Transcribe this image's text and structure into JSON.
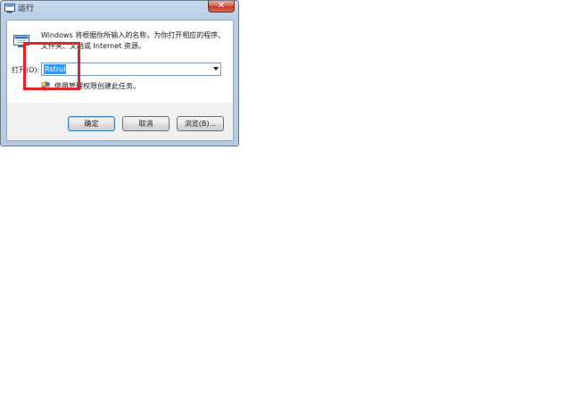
{
  "dialog": {
    "title": "运行",
    "close_glyph": "✕",
    "description": "Windows 将根据你所输入的名称，为你打开相应的程序、文件夹、文档或 Internet 资源。",
    "open_label": "打开(O):",
    "open_value": "Rstrui",
    "admin_note": "使用管理权限创建此任务。",
    "buttons": {
      "ok": "确定",
      "cancel": "取消",
      "browse": "浏览(B)..."
    }
  },
  "icons": {
    "title": "run-app-icon",
    "main": "run-app-icon",
    "shield": "uac-shield-icon",
    "dropdown": "chevron-down-icon"
  },
  "colors": {
    "highlight": "#e0262b",
    "selection": "#3399ff",
    "close_button": "#c0391f"
  }
}
